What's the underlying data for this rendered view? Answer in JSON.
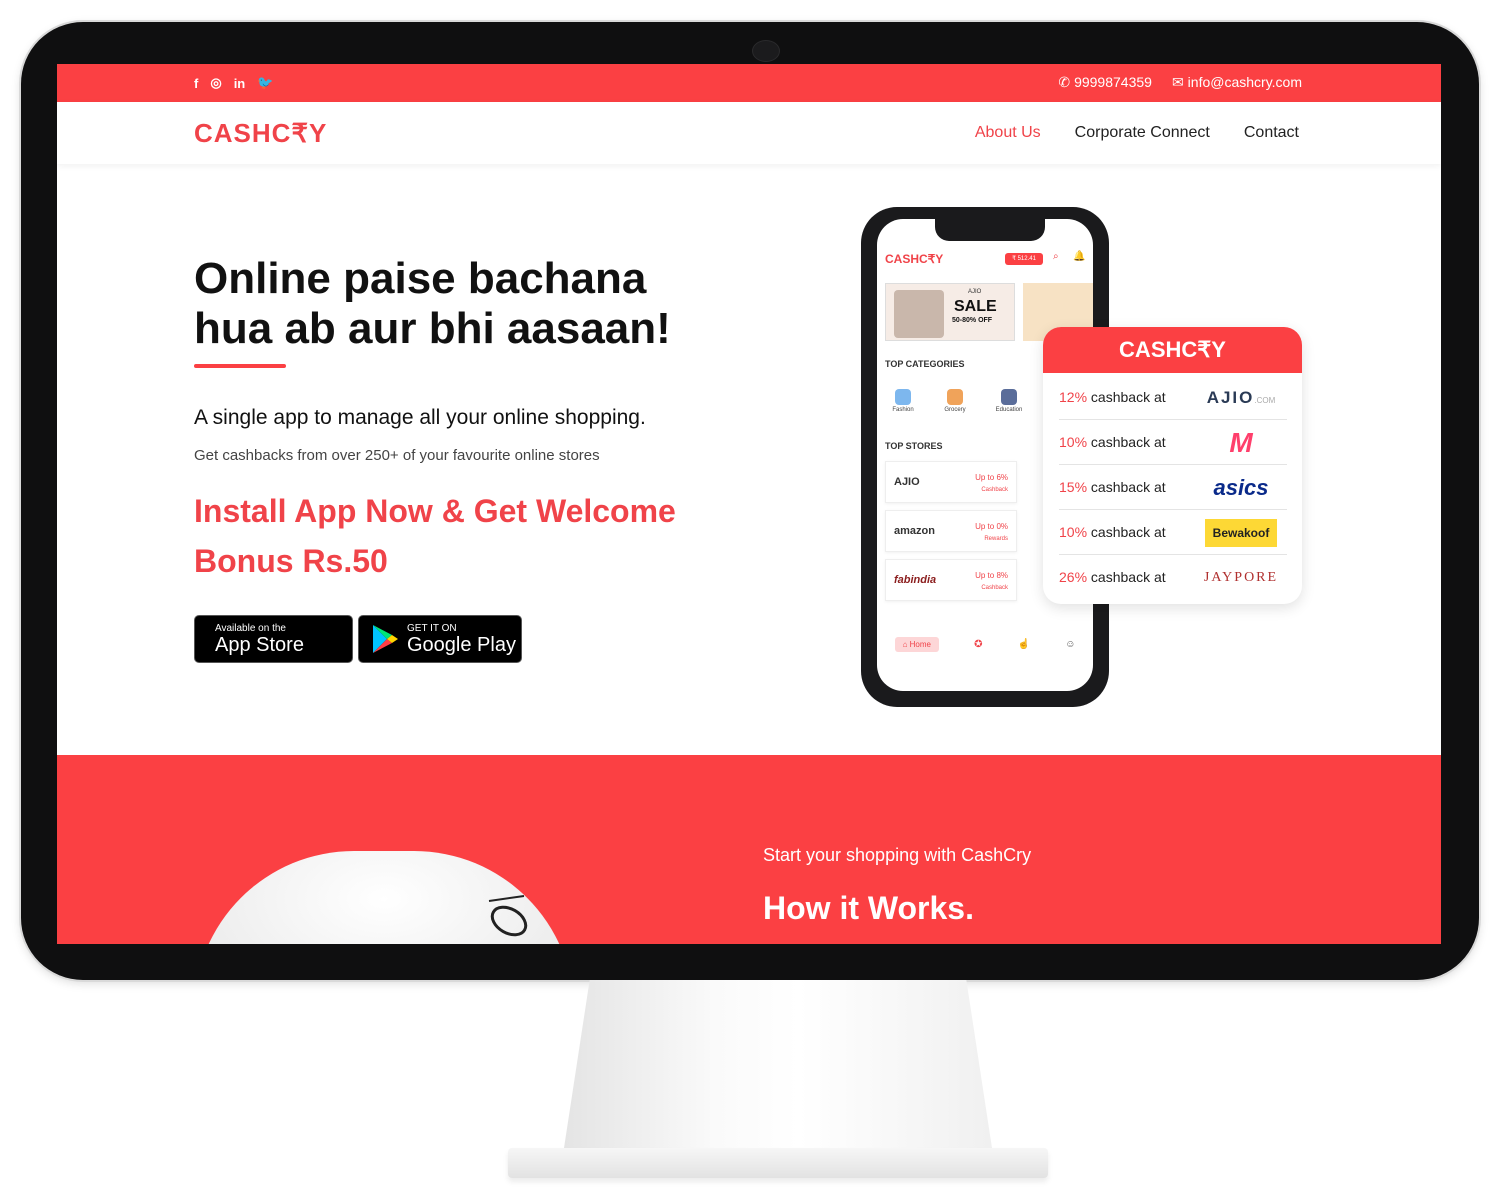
{
  "topbar": {
    "social": [
      "f",
      "◎",
      "in",
      "🐦"
    ],
    "phone": "9999874359",
    "email": "info@cashcry.com"
  },
  "nav": {
    "logo": "CASHC₹Y",
    "menu": [
      "About Us",
      "Corporate Connect",
      "Contact"
    ],
    "active_index": 0
  },
  "hero": {
    "title_line1": "Online paise bachana",
    "title_line2": "hua ab aur bhi aasaan!",
    "subtitle": "A single app to manage all your online shopping.",
    "description": "Get cashbacks from over 250+ of your favourite online stores",
    "promo": "Install App Now & Get Welcome Bonus Rs.50",
    "app_store": {
      "small": "Available on the",
      "big": "App Store"
    },
    "google_play": {
      "small": "GET IT ON",
      "big": "Google Play"
    }
  },
  "phone": {
    "logo": "CASHC₹Y",
    "wallet": "₹ 512.41",
    "banner_brand": "AJIO",
    "banner_sale": "SALE",
    "banner_off": "50-80% OFF",
    "top_categories": "TOP CATEGORIES",
    "categories": [
      "Fashion",
      "Grocery",
      "Education"
    ],
    "top_stores": "TOP STORES",
    "stores": [
      {
        "name": "AJIO",
        "cb1": "Up to 6%",
        "cb2": "Cashback"
      },
      {
        "name": "amazon",
        "cb1": "Up to 0%",
        "cb2": "Rewards"
      },
      {
        "name": "fabindia",
        "cb1": "Up to 8%",
        "cb2": "Cashback"
      }
    ],
    "tab_home": "Home"
  },
  "card": {
    "title": "CASHC₹Y",
    "rows": [
      {
        "pct": "12%",
        "text": " cashback at",
        "brand": "AJIO"
      },
      {
        "pct": "10%",
        "text": " cashback at",
        "brand": "M"
      },
      {
        "pct": "15%",
        "text": " cashback at",
        "brand": "asics"
      },
      {
        "pct": "10%",
        "text": " cashback at",
        "brand": "Bewakoof"
      },
      {
        "pct": "26%",
        "text": " cashback at",
        "brand": "JAYPORE"
      }
    ],
    "ajio_suffix": ".COM"
  },
  "how": {
    "kicker": "Start your shopping with CashCry",
    "title": "How it Works."
  },
  "colors": {
    "brand": "#fb4043",
    "accent_text": "#f04349"
  }
}
